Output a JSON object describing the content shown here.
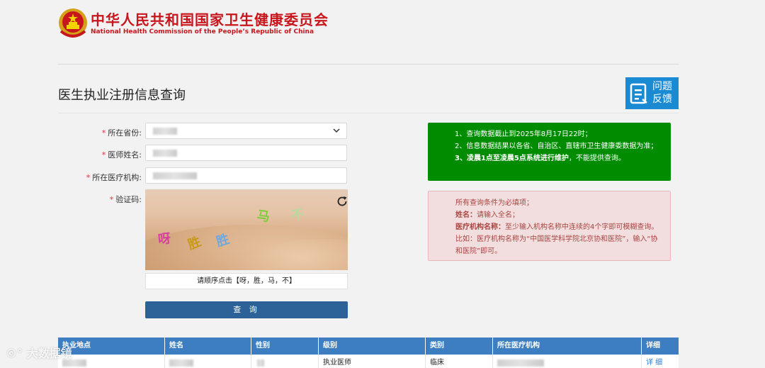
{
  "header": {
    "title_cn": "中华人民共和国国家卫生健康委员会",
    "title_en": "National Health Commission of the People’s Republic of China"
  },
  "page": {
    "title": "医生执业注册信息查询"
  },
  "feedback": {
    "label": "问题反馈"
  },
  "form": {
    "province_label": "所在省份:",
    "name_label": "医师姓名:",
    "institution_label": "所在医疗机构:",
    "captcha_label": "验证码:",
    "required_mark": "*",
    "captcha_chars": [
      "马",
      "不",
      "呀",
      "胜",
      "胜"
    ],
    "captcha_hint": "请顺序点击【呀，胜，马，不】",
    "query_button": "查 询"
  },
  "notice_green": {
    "line1": "1、查询数据截止到2025年8月17日22时；",
    "line2": "2、信息数据结果以各省、自治区、直辖市卫生健康委数据为准；",
    "line3_bold": "3、凌晨1点至凌晨5点系统进行维护",
    "line3_rest": "，不能提供查询。"
  },
  "notice_red": {
    "line1": "所有查询条件为必填项；",
    "line2_bold": "姓名：",
    "line2_rest": "请输入全名；",
    "line3_bold": "医疗机构名称：",
    "line3_rest": "至少输入机构名称中连续的4个字即可模糊查询。比如：医疗机构名称为“中国医学科学院北京协和医院”，输入“协和医院”即可。"
  },
  "table": {
    "headers": [
      "执业地点",
      "姓名",
      "性别",
      "级别",
      "类别",
      "所在医疗机构",
      "详细"
    ],
    "row": {
      "level": "执业医师",
      "category": "临床",
      "detail": "详 细"
    }
  },
  "watermark": {
    "text": "大数据镜"
  },
  "colors": {
    "brand_red": "#c8161d",
    "table_header": "#3d7ec2",
    "query_button": "#2c6297",
    "notice_green": "#008c00",
    "notice_red_bg": "#f2dede"
  }
}
